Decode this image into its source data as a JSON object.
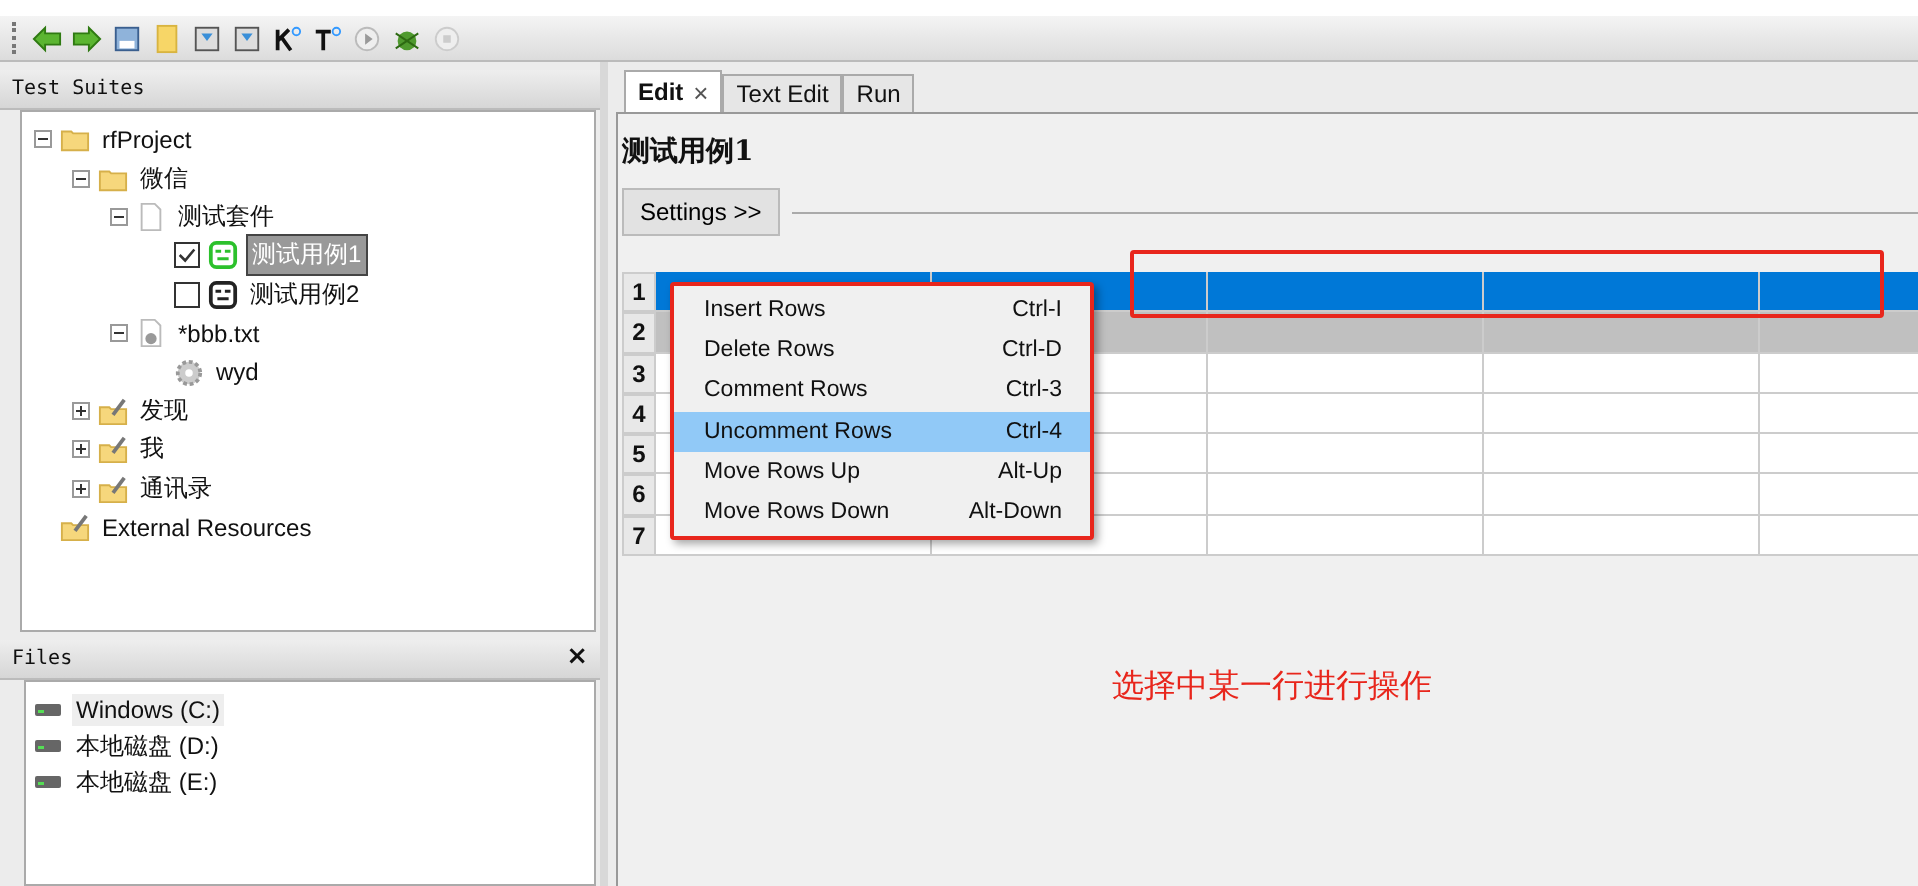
{
  "left_panel": {
    "title": "Test Suites",
    "tree": [
      {
        "label": "rfProject",
        "kind": "folder",
        "expanded": true,
        "children": [
          {
            "label": "微信",
            "kind": "folder",
            "expanded": true,
            "children": [
              {
                "label": "测试套件",
                "kind": "suite",
                "expanded": true,
                "children": [
                  {
                    "label": "测试用例1",
                    "kind": "test",
                    "checked": true,
                    "selected": true
                  },
                  {
                    "label": "测试用例2",
                    "kind": "test",
                    "checked": false,
                    "selected": false
                  }
                ]
              },
              {
                "label": "*bbb.txt",
                "kind": "resource_file",
                "expanded": true,
                "children": [
                  {
                    "label": "wyd",
                    "kind": "keyword"
                  }
                ]
              }
            ]
          },
          {
            "label": "发现",
            "kind": "library",
            "expanded": false
          },
          {
            "label": "我",
            "kind": "library",
            "expanded": false
          },
          {
            "label": "通讯录",
            "kind": "library",
            "expanded": false
          }
        ]
      },
      {
        "label": "External Resources",
        "kind": "library"
      }
    ]
  },
  "files_panel": {
    "title": "Files",
    "close": "×",
    "drives": [
      {
        "label": "Windows (C:)",
        "selected": true
      },
      {
        "label": "本地磁盘 (D:)",
        "selected": false
      },
      {
        "label": "本地磁盘 (E:)",
        "selected": false
      }
    ]
  },
  "tabs": [
    {
      "label": "Edit",
      "selected": true,
      "close": "×"
    },
    {
      "label": "Text Edit",
      "selected": false
    },
    {
      "label": "Run",
      "selected": false
    }
  ],
  "editor": {
    "title": "测试用例1",
    "settings_button": "Settings >>",
    "rows": [
      {
        "number": "1",
        "selected": true,
        "shaded": false
      },
      {
        "number": "2",
        "selected": false,
        "shaded": true
      },
      {
        "number": "3",
        "selected": false,
        "shaded": false
      },
      {
        "number": "4",
        "selected": false,
        "shaded": false
      },
      {
        "number": "5",
        "selected": false,
        "shaded": false
      },
      {
        "number": "6",
        "selected": false,
        "shaded": false
      },
      {
        "number": "7",
        "selected": false,
        "shaded": false
      }
    ]
  },
  "context_menu": [
    {
      "label": "Insert Rows",
      "shortcut": "Ctrl-I",
      "selected": false
    },
    {
      "label": "Delete Rows",
      "shortcut": "Ctrl-D",
      "selected": false
    },
    {
      "label": "Comment Rows",
      "shortcut": "Ctrl-3",
      "selected": false
    },
    {
      "label": "Uncomment Rows",
      "shortcut": "Ctrl-4",
      "selected": true
    },
    {
      "label": "Move Rows Up",
      "shortcut": "Alt-Up",
      "selected": false
    },
    {
      "label": "Move Rows Down",
      "shortcut": "Alt-Down",
      "selected": false
    }
  ],
  "annotation": "选择中某一行进行操作"
}
